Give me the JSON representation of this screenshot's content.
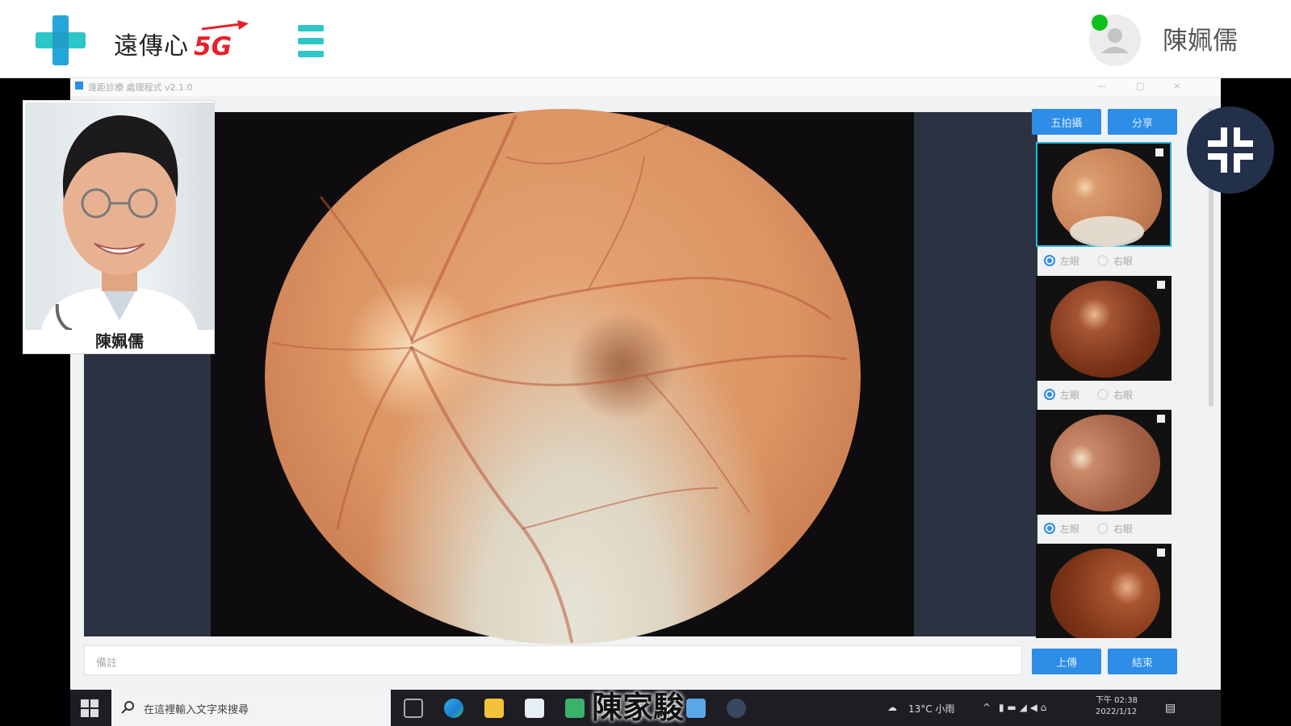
{
  "header": {
    "brand_text": "遠傳心",
    "brand_suffix": "5G",
    "user_name": "陳姵儒",
    "colors": {
      "accent": "#2ec6c6",
      "brand_red": "#e8202a",
      "online": "#10c020"
    }
  },
  "caption": "陳家駿",
  "pip": {
    "name": "陳姵儒"
  },
  "remote_window": {
    "title": "遠距診療 處理程式 v2.1.0",
    "controls": [
      "—",
      "□",
      "×"
    ],
    "buttons": {
      "top_left": "五拍攝",
      "top_right": "分享",
      "upload": "上傳",
      "finish": "結束"
    },
    "note_placeholder": "備註",
    "radio_left": "左眼",
    "radio_right": "右眼"
  },
  "taskbar": {
    "search_placeholder": "在這裡輸入文字來搜尋",
    "weather": "13°C 小雨",
    "time": "下午 02:38",
    "date": "2022/1/12"
  }
}
